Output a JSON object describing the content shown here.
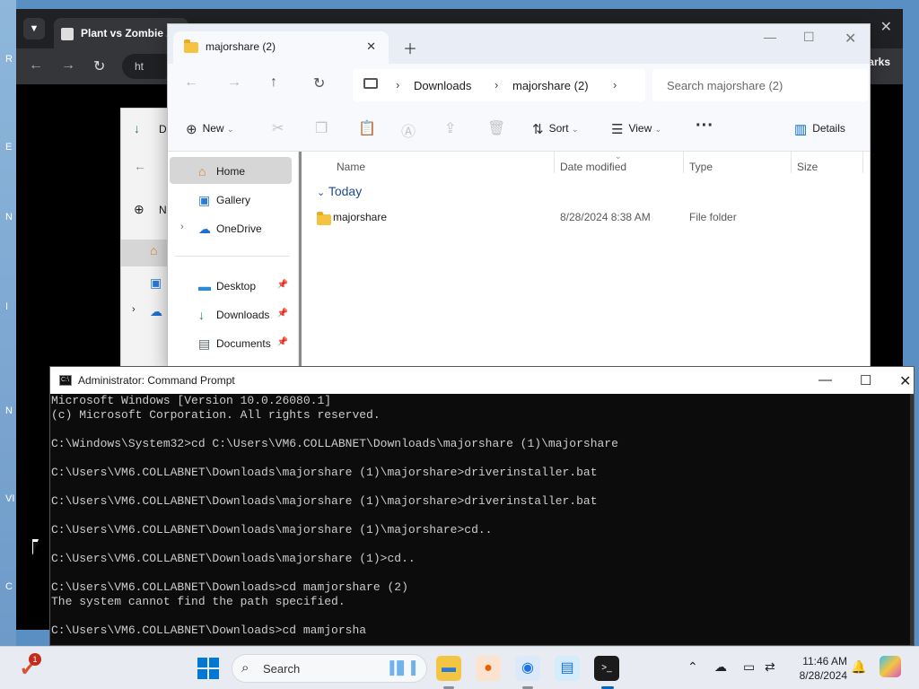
{
  "desktop": {
    "side_labels": [
      "R",
      "E",
      "N",
      "I",
      "N",
      "VI",
      "C"
    ]
  },
  "browser": {
    "tab_title": "Plant vs Zombie Z",
    "url_fragment": "ht",
    "bookmarks_fragment": "arks"
  },
  "explorer_bg": {
    "item1": "D",
    "item2": "N"
  },
  "explorer": {
    "tab_title": "majorshare (2)",
    "breadcrumb": [
      "Downloads",
      "majorshare (2)"
    ],
    "search_placeholder": "Search majorshare (2)",
    "commands": {
      "new": "New",
      "sort": "Sort",
      "view": "View",
      "details": "Details"
    },
    "sidebar": [
      {
        "label": "Home",
        "icon": "home-icon"
      },
      {
        "label": "Gallery",
        "icon": "gallery-icon"
      },
      {
        "label": "OneDrive",
        "icon": "onedrive-icon"
      },
      {
        "label": "Desktop",
        "icon": "desktop-icon"
      },
      {
        "label": "Downloads",
        "icon": "download-icon"
      },
      {
        "label": "Documents",
        "icon": "documents-icon"
      }
    ],
    "columns": [
      "Name",
      "Date modified",
      "Type",
      "Size"
    ],
    "group": "Today",
    "files": [
      {
        "name": "majorshare",
        "date": "8/28/2024 8:38 AM",
        "type": "File folder",
        "size": ""
      }
    ]
  },
  "cmd": {
    "title": "Administrator: Command Prompt",
    "lines": [
      "Microsoft Windows [Version 10.0.26080.1]",
      "(c) Microsoft Corporation. All rights reserved.",
      "",
      "C:\\Windows\\System32>cd C:\\Users\\VM6.COLLABNET\\Downloads\\majorshare (1)\\majorshare",
      "",
      "C:\\Users\\VM6.COLLABNET\\Downloads\\majorshare (1)\\majorshare>driverinstaller.bat",
      "",
      "C:\\Users\\VM6.COLLABNET\\Downloads\\majorshare (1)\\majorshare>driverinstaller.bat",
      "",
      "C:\\Users\\VM6.COLLABNET\\Downloads\\majorshare (1)\\majorshare>cd..",
      "",
      "C:\\Users\\VM6.COLLABNET\\Downloads\\majorshare (1)>cd..",
      "",
      "C:\\Users\\VM6.COLLABNET\\Downloads>cd mamjorshare (2)",
      "The system cannot find the path specified.",
      "",
      "C:\\Users\\VM6.COLLABNET\\Downloads>cd mamjorsha"
    ]
  },
  "taskbar": {
    "notification_count": "1",
    "search_label": "Search",
    "time": "11:46 AM",
    "date": "8/28/2024"
  }
}
